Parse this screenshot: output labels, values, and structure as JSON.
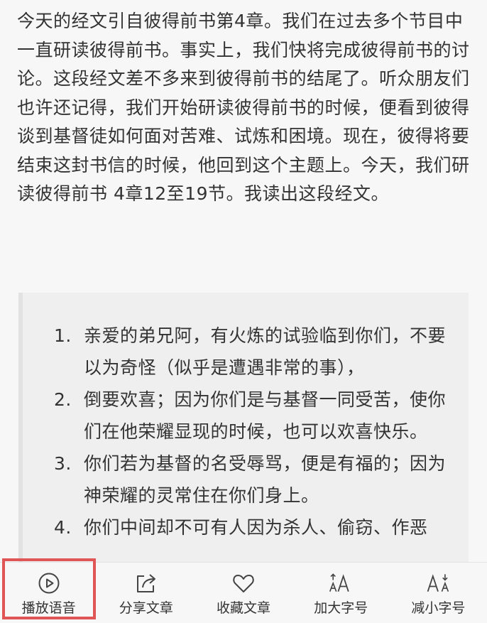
{
  "article": {
    "paragraph": "今天的经文引自彼得前书第4章。我们在过去多个节目中一直研读彼得前书。事实上，我们快将完成彼得前书的讨论。这段经文差不多来到彼得前书的结尾了。听众朋友们也许还记得，我们开始研读彼得前书的时候，便看到彼得谈到基督徒如何面对苦难、试炼和困境。现在，彼得将要结束这封书信的时候，他回到这个主题上。今天，我们研读彼得前书 4章12至19节。我读出这段经文。"
  },
  "quote": {
    "verses": [
      {
        "num": "1.",
        "text": "亲爱的弟兄阿，有火炼的试验临到你们，不要以为奇怪（似乎是遭遇非常的事），"
      },
      {
        "num": "2.",
        "text": "倒要欢喜；因为你们是与基督一同受苦，使你们在他荣耀显现的时候，也可以欢喜快乐。"
      },
      {
        "num": "3.",
        "text": "你们若为基督的名受辱骂，便是有福的；因为神荣耀的灵常住在你们身上。"
      },
      {
        "num": "4.",
        "text": "你们中间却不可有人因为杀人、偷窃、作恶"
      }
    ]
  },
  "toolbar": {
    "play": {
      "label": "播放语音",
      "icon": "play-circle-icon"
    },
    "share": {
      "label": "分享文章",
      "icon": "share-icon"
    },
    "favorite": {
      "label": "收藏文章",
      "icon": "heart-icon"
    },
    "font_up": {
      "label": "加大字号",
      "icon": "font-increase-icon"
    },
    "font_down": {
      "label": "减小字号",
      "icon": "font-decrease-icon"
    }
  },
  "colors": {
    "highlight": "#e05656",
    "text": "#333333",
    "background": "#f7f7f7",
    "quote_background": "#efefef"
  }
}
